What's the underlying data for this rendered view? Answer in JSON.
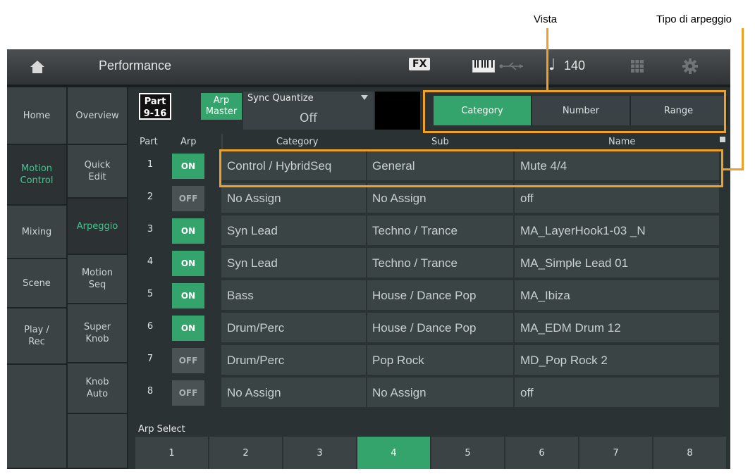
{
  "annotations": {
    "view": "Vista",
    "arp_type": "Tipo di arpeggio"
  },
  "topbar": {
    "title": "Performance",
    "fx": "FX",
    "note_symbol": "♩",
    "tempo": "140",
    "icons": [
      "home-icon",
      "keyboard-icon",
      "usb-icon",
      "grid-icon",
      "gear-icon"
    ]
  },
  "left_tabs": [
    {
      "label": "Home"
    },
    {
      "label": "Motion Control",
      "active": true
    },
    {
      "label": "Mixing"
    },
    {
      "label": "Scene"
    },
    {
      "label": "Play / Rec"
    }
  ],
  "sub_tabs": [
    {
      "label": "Overview"
    },
    {
      "label": "Quick Edit"
    },
    {
      "label": "Arpeggio",
      "active": true
    },
    {
      "label": "Motion Seq"
    },
    {
      "label": "Super Knob"
    },
    {
      "label": "Knob Auto"
    }
  ],
  "controls": {
    "part_button": "Part 9-16",
    "arp_master": "Arp Master",
    "sync_quantize": {
      "label": "Sync Quantize",
      "value": "Off"
    },
    "view_buttons": [
      {
        "label": "Category",
        "active": true
      },
      {
        "label": "Number"
      },
      {
        "label": "Range"
      }
    ]
  },
  "table": {
    "headers": {
      "part": "Part",
      "arp": "Arp",
      "category": "Category",
      "sub": "Sub",
      "name": "Name"
    },
    "rows": [
      {
        "part": "1",
        "arp": "ON",
        "category": "Control / HybridSeq",
        "sub": "General",
        "name": "Mute 4/4"
      },
      {
        "part": "2",
        "arp": "OFF",
        "category": "No Assign",
        "sub": "No Assign",
        "name": "off"
      },
      {
        "part": "3",
        "arp": "ON",
        "category": "Syn Lead",
        "sub": "Techno / Trance",
        "name": "MA_LayerHook1-03 _N"
      },
      {
        "part": "4",
        "arp": "ON",
        "category": "Syn Lead",
        "sub": "Techno / Trance",
        "name": "MA_Simple Lead 01"
      },
      {
        "part": "5",
        "arp": "ON",
        "category": "Bass",
        "sub": "House / Dance Pop",
        "name": "MA_Ibiza"
      },
      {
        "part": "6",
        "arp": "ON",
        "category": "Drum/Perc",
        "sub": "House / Dance Pop",
        "name": "MA_EDM Drum 12"
      },
      {
        "part": "7",
        "arp": "OFF",
        "category": "Drum/Perc",
        "sub": "Pop Rock",
        "name": "MD_Pop Rock 2"
      },
      {
        "part": "8",
        "arp": "OFF",
        "category": "No Assign",
        "sub": "No Assign",
        "name": "off"
      }
    ]
  },
  "arp_select": {
    "label": "Arp Select",
    "buttons": [
      "1",
      "2",
      "3",
      "4",
      "5",
      "6",
      "7",
      "8"
    ],
    "active": "4"
  },
  "colors": {
    "accent_green": "#35a36c",
    "highlight_orange": "#f0a024",
    "active_text": "#3ec68e"
  }
}
